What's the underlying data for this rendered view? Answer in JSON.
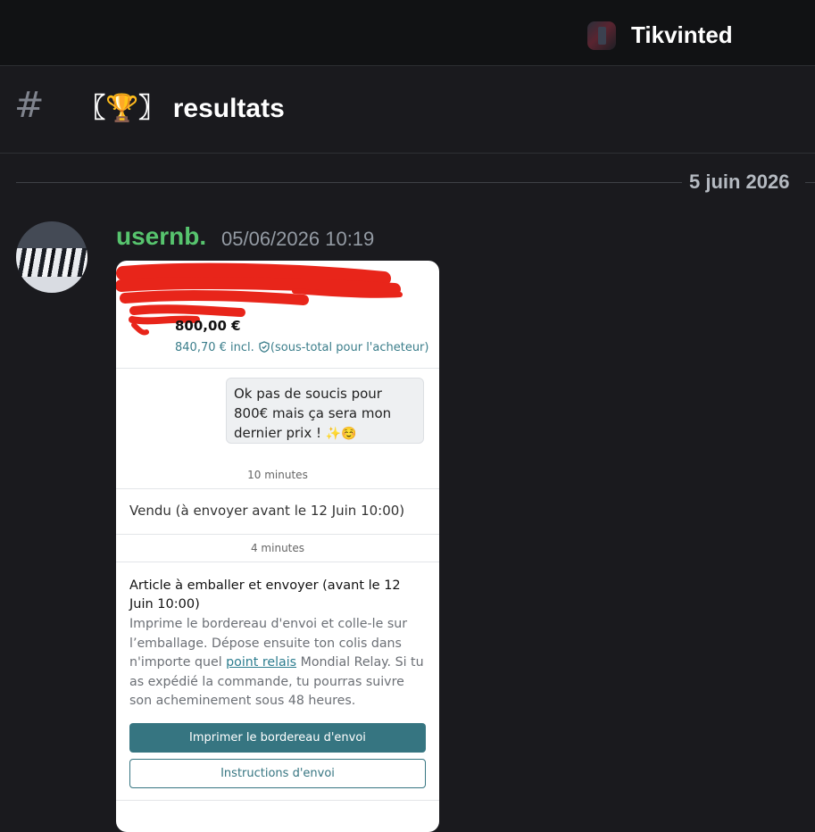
{
  "app": {
    "server_name": "Tikvinted",
    "channel": {
      "name": "resultats",
      "emoji": "🏆",
      "bracket_left": "〖",
      "bracket_right": "〗"
    },
    "colors": {
      "background": "#1a1a1e",
      "topbar": "#111214",
      "username": "#57c46e",
      "timestamp": "#949ba4",
      "attachment_accent": "#367581"
    }
  },
  "date_divider": "5 juin 2026",
  "message": {
    "username": "usernb.",
    "timestamp": "05/06/2026 10:19",
    "attachment": {
      "price": "800,00 €",
      "price_incl": "840,70 € incl.",
      "price_incl_note": "(sous-total pour l'acheteur)",
      "bubble_text": "Ok pas de soucis pour 800€ mais ça sera mon dernier prix !",
      "bubble_emoji": "✨☺️",
      "time_1": "10 minutes",
      "status": "Vendu (à envoyer avant le 12 Juin 10:00)",
      "time_2": "4 minutes",
      "heading": "Article à emballer et envoyer (avant le 12 Juin 10:00)",
      "body_before_link": "Imprime le bordereau d'envoi et colle-le sur l’emballage. Dépose ensuite ton colis dans n'importe quel ",
      "body_link": "point relais",
      "body_after_link": " Mondial Relay. Si tu as expédié la commande, tu pourras suivre son acheminement sous 48 heures.",
      "button_primary": "Imprimer le bordereau d'envoi",
      "button_secondary": "Instructions d'envoi",
      "redaction_color": "#e8251a"
    }
  }
}
